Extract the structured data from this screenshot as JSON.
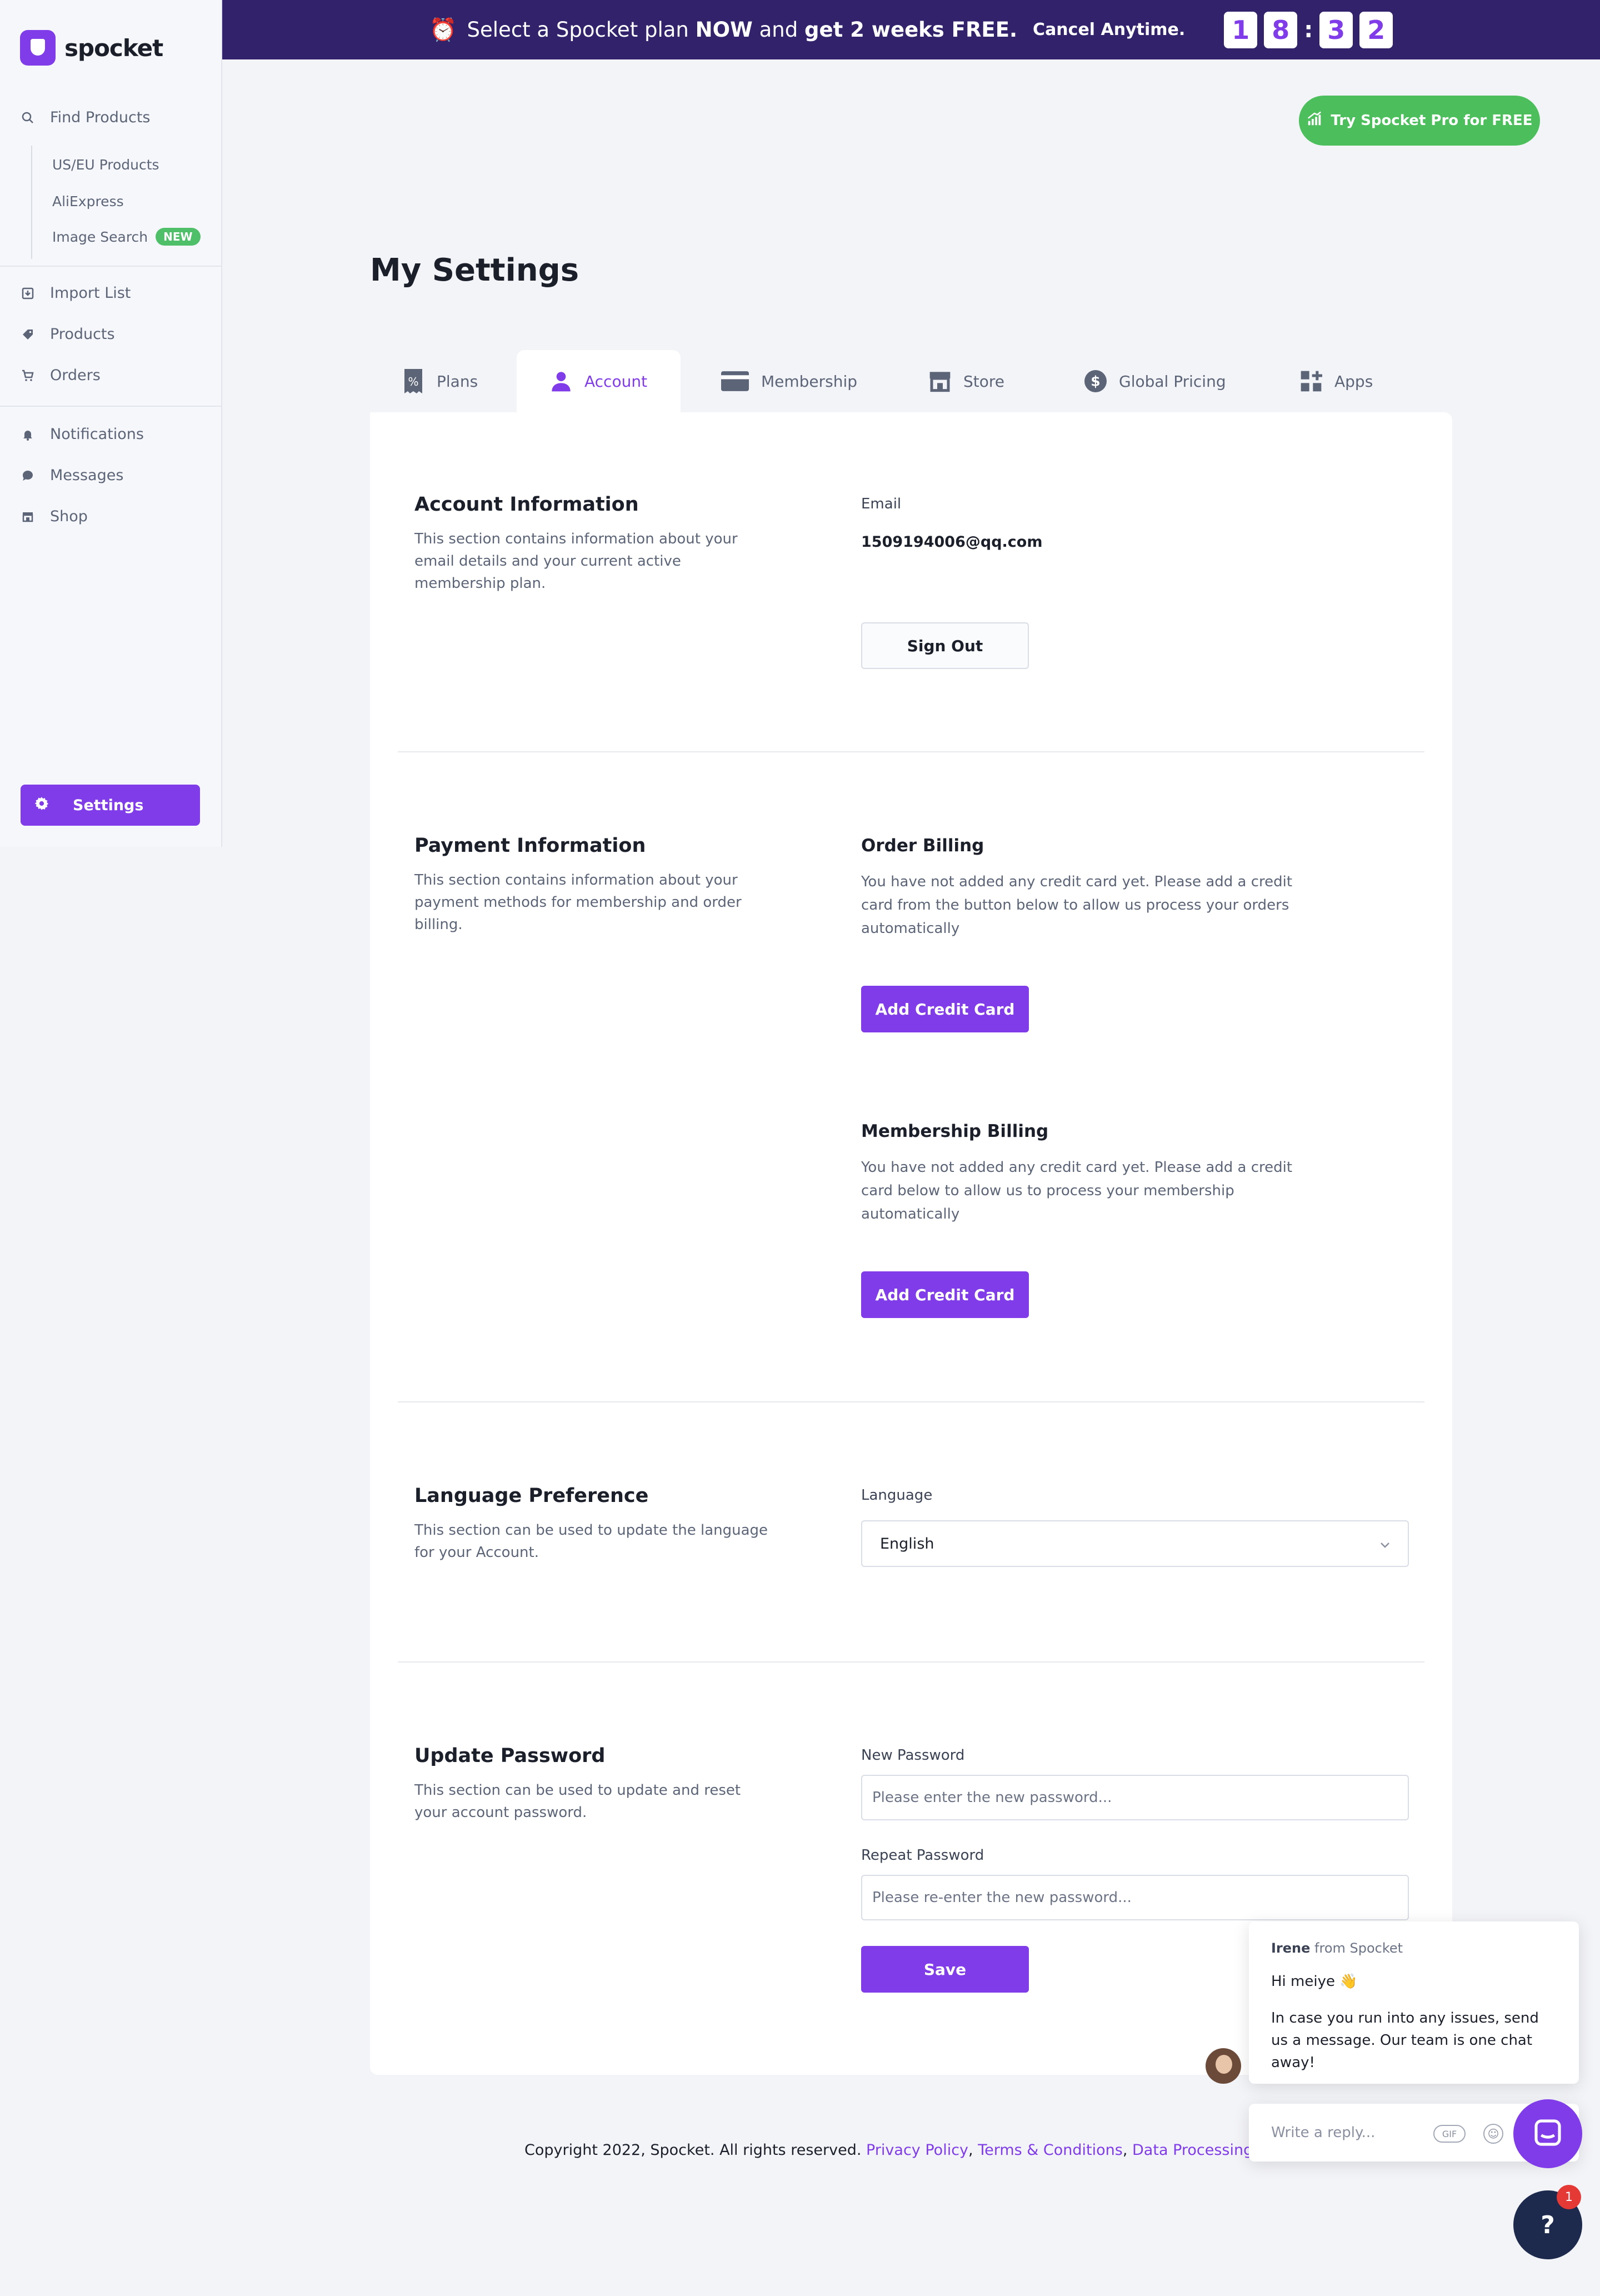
{
  "brand": {
    "name": "spocket"
  },
  "sidebar": {
    "find_products": "Find Products",
    "sub_items": [
      {
        "label": "US/EU Products"
      },
      {
        "label": "AliExpress"
      },
      {
        "label": "Image Search",
        "badge": "NEW"
      }
    ],
    "items": [
      {
        "label": "Import List",
        "icon": "import-icon"
      },
      {
        "label": "Products",
        "icon": "tag-icon"
      },
      {
        "label": "Orders",
        "icon": "cart-icon"
      },
      {
        "label": "Notifications",
        "icon": "bell-icon"
      },
      {
        "label": "Messages",
        "icon": "chat-icon"
      },
      {
        "label": "Shop",
        "icon": "store-icon"
      }
    ],
    "settings": "Settings"
  },
  "banner": {
    "part1": "Select a Spocket plan",
    "now": "NOW",
    "and": "and",
    "free": "get 2 weeks FREE.",
    "cancel": "Cancel Anytime.",
    "timer": [
      "1",
      "8",
      "3",
      "2"
    ]
  },
  "try_pro": "Try Spocket Pro for FREE",
  "page_title": "My Settings",
  "tabs": [
    {
      "label": "Plans",
      "icon": "plans-icon"
    },
    {
      "label": "Account",
      "icon": "user-icon",
      "active": true
    },
    {
      "label": "Membership",
      "icon": "card-icon"
    },
    {
      "label": "Store",
      "icon": "store-icon"
    },
    {
      "label": "Global Pricing",
      "icon": "dollar-icon"
    },
    {
      "label": "Apps",
      "icon": "apps-icon"
    }
  ],
  "account": {
    "title": "Account Information",
    "desc": "This section contains information about your email details and your current active membership plan.",
    "email_label": "Email",
    "email_value": "1509194006@qq.com",
    "sign_out": "Sign Out"
  },
  "payment": {
    "title": "Payment Information",
    "desc": "This section contains information about your payment methods for membership and order billing.",
    "order_title": "Order Billing",
    "order_text": "You have not added any credit card yet. Please add a credit card from the button below to allow us process your orders automatically",
    "add_card": "Add Credit Card",
    "membership_title": "Membership Billing",
    "membership_text": "You have not added any credit card yet. Please add a credit card below to allow us to process your membership automatically"
  },
  "language": {
    "title": "Language Preference",
    "desc": "This section can be used to update the language for your Account.",
    "label": "Language",
    "value": "English"
  },
  "password": {
    "title": "Update Password",
    "desc": "This section can be used to update and reset your account password.",
    "new_label": "New Password",
    "new_placeholder": "Please enter the new password...",
    "repeat_label": "Repeat Password",
    "repeat_placeholder": "Please re-enter the new password...",
    "save": "Save"
  },
  "footer": {
    "copyright": "Copyright 2022, Spocket. All rights reserved.",
    "privacy": "Privacy Policy",
    "terms": "Terms & Conditions",
    "dpa": "Data Processing Adde"
  },
  "chat": {
    "sender": "Irene",
    "from": "from Spocket",
    "greeting": "Hi meiye 👋",
    "message": "In case you run into any issues, send us a message. Our team is one chat away!",
    "reply_placeholder": "Write a reply...",
    "gif": "GIF",
    "help": "?",
    "help_count": "1"
  },
  "colors": {
    "accent": "#7f3ce8",
    "banner": "#32226b",
    "green": "#4cbf5c"
  }
}
